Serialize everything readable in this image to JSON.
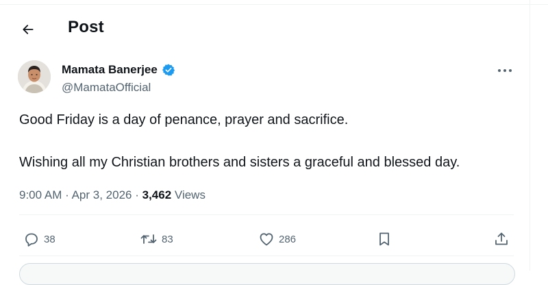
{
  "header": {
    "title": "Post"
  },
  "post": {
    "author_name": "Mamata Banerjee",
    "author_handle": "@MamataOfficial",
    "text_line1": "Good Friday is a day of penance, prayer and sacrifice.",
    "text_line2": "Wishing all my Christian brothers and sisters a graceful and blessed day.",
    "time": "9:00 AM",
    "date": "Apr 3, 2026",
    "separator": "·",
    "views_count": "3,462",
    "views_label": "Views"
  },
  "actions": {
    "replies": "38",
    "reposts": "83",
    "likes": "286"
  },
  "icons": {
    "back": "arrow-left-icon",
    "verified": "verified-badge-icon",
    "more": "more-dots-icon",
    "reply": "reply-icon",
    "repost": "repost-icon",
    "like": "heart-icon",
    "bookmark": "bookmark-icon",
    "share": "share-icon"
  },
  "colors": {
    "text": "#0f1419",
    "secondary": "#536471",
    "verified": "#1d9bf0",
    "divider": "#eff3f4"
  }
}
